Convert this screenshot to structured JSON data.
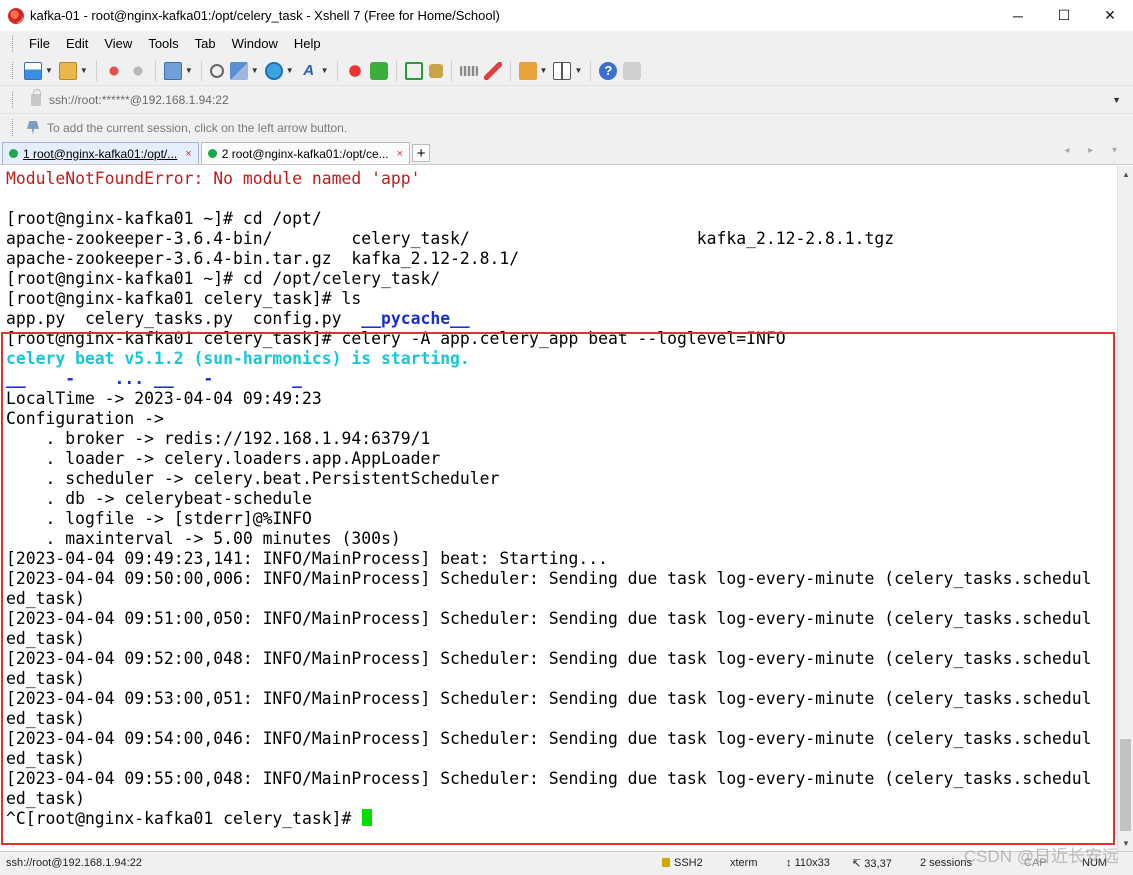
{
  "window": {
    "title": "kafka-01 - root@nginx-kafka01:/opt/celery_task - Xshell 7 (Free for Home/School)",
    "controls": {
      "minimize": "─",
      "maximize": "☐",
      "close": "✕"
    }
  },
  "menu": {
    "items": [
      "File",
      "Edit",
      "View",
      "Tools",
      "Tab",
      "Window",
      "Help"
    ]
  },
  "toolbar": {
    "icons": [
      "new-session-icon",
      "open-folder-icon",
      "reconnect-icon",
      "disconnect-icon",
      "properties-icon",
      "find-icon",
      "transfer-icon",
      "globe-icon",
      "font-icon",
      "xftp-icon",
      "xmanager-icon",
      "fullscreen-icon",
      "lock-icon",
      "keyboard-icon",
      "highlight-icon",
      "compose-icon",
      "layout-icon",
      "help-icon",
      "chat-icon"
    ]
  },
  "address": {
    "value": "ssh://root:******@192.168.1.94:22"
  },
  "hint": {
    "text": "To add the current session, click on the left arrow button."
  },
  "tabs": [
    {
      "label": "1 root@nginx-kafka01:/opt/...",
      "active": true,
      "close": "×"
    },
    {
      "label": "2 root@nginx-kafka01:/opt/ce...",
      "active": false,
      "close": "×"
    }
  ],
  "tab_add": "+",
  "tab_nav": "◂ ▸ ▾",
  "terminal": {
    "lines": [
      {
        "text": "ModuleNotFoundError: No module named 'app'",
        "style": "red"
      },
      {
        "text": "",
        "style": "normal"
      },
      {
        "text": "[root@nginx-kafka01 ~]# cd /opt/",
        "style": "normal"
      },
      {
        "text": "apache-zookeeper-3.6.4-bin/        celery_task/                       kafka_2.12-2.8.1.tgz",
        "style": "normal"
      },
      {
        "text": "apache-zookeeper-3.6.4-bin.tar.gz  kafka_2.12-2.8.1/",
        "style": "normal"
      },
      {
        "text": "[root@nginx-kafka01 ~]# cd /opt/celery_task/",
        "style": "normal"
      },
      {
        "text": "[root@nginx-kafka01 celery_task]# ls",
        "style": "normal"
      },
      {
        "text": "app.py  celery_tasks.py  config.py  ",
        "style": "normal",
        "suffix": "__pycache__",
        "suffix_style": "blue"
      },
      {
        "text": "[root@nginx-kafka01 celery_task]# celery -A app.celery_app beat --loglevel=INFO",
        "style": "normal"
      },
      {
        "text": "celery beat v5.1.2 (sun-harmonics) is starting.",
        "style": "cyan"
      },
      {
        "text": "__    -    ... __   -        _",
        "style": "blue"
      },
      {
        "text": "LocalTime -> 2023-04-04 09:49:23",
        "style": "normal"
      },
      {
        "text": "Configuration ->",
        "style": "normal"
      },
      {
        "text": "    . broker -> redis://192.168.1.94:6379/1",
        "style": "normal"
      },
      {
        "text": "    . loader -> celery.loaders.app.AppLoader",
        "style": "normal"
      },
      {
        "text": "    . scheduler -> celery.beat.PersistentScheduler",
        "style": "normal"
      },
      {
        "text": "    . db -> celerybeat-schedule",
        "style": "normal"
      },
      {
        "text": "    . logfile -> [stderr]@%INFO",
        "style": "normal"
      },
      {
        "text": "    . maxinterval -> 5.00 minutes (300s)",
        "style": "normal"
      },
      {
        "text": "[2023-04-04 09:49:23,141: INFO/MainProcess] beat: Starting...",
        "style": "normal"
      },
      {
        "text": "[2023-04-04 09:50:00,006: INFO/MainProcess] Scheduler: Sending due task log-every-minute (celery_tasks.schedul",
        "style": "normal"
      },
      {
        "text": "ed_task)",
        "style": "normal"
      },
      {
        "text": "[2023-04-04 09:51:00,050: INFO/MainProcess] Scheduler: Sending due task log-every-minute (celery_tasks.schedul",
        "style": "normal"
      },
      {
        "text": "ed_task)",
        "style": "normal"
      },
      {
        "text": "[2023-04-04 09:52:00,048: INFO/MainProcess] Scheduler: Sending due task log-every-minute (celery_tasks.schedul",
        "style": "normal"
      },
      {
        "text": "ed_task)",
        "style": "normal"
      },
      {
        "text": "[2023-04-04 09:53:00,051: INFO/MainProcess] Scheduler: Sending due task log-every-minute (celery_tasks.schedul",
        "style": "normal"
      },
      {
        "text": "ed_task)",
        "style": "normal"
      },
      {
        "text": "[2023-04-04 09:54:00,046: INFO/MainProcess] Scheduler: Sending due task log-every-minute (celery_tasks.schedul",
        "style": "normal"
      },
      {
        "text": "ed_task)",
        "style": "normal"
      },
      {
        "text": "[2023-04-04 09:55:00,048: INFO/MainProcess] Scheduler: Sending due task log-every-minute (celery_tasks.schedul",
        "style": "normal"
      },
      {
        "text": "ed_task)",
        "style": "normal"
      },
      {
        "text": "^C[root@nginx-kafka01 celery_task]# ",
        "style": "normal",
        "cursor": true
      }
    ]
  },
  "status": {
    "connection": "ssh://root@192.168.1.94:22",
    "protocol": "SSH2",
    "terminal": "xterm",
    "size": "110x33",
    "position": "33,37",
    "sessions": "2 sessions",
    "caps": "CAP",
    "num": "NUM"
  },
  "watermark": "CSDN @日近长安远",
  "colors": {
    "error_red": "#c01c1c",
    "cyan": "#14c8d8",
    "blue": "#1a2fd0",
    "cursor_green": "#00dd00",
    "highlight_border": "#e03030"
  }
}
